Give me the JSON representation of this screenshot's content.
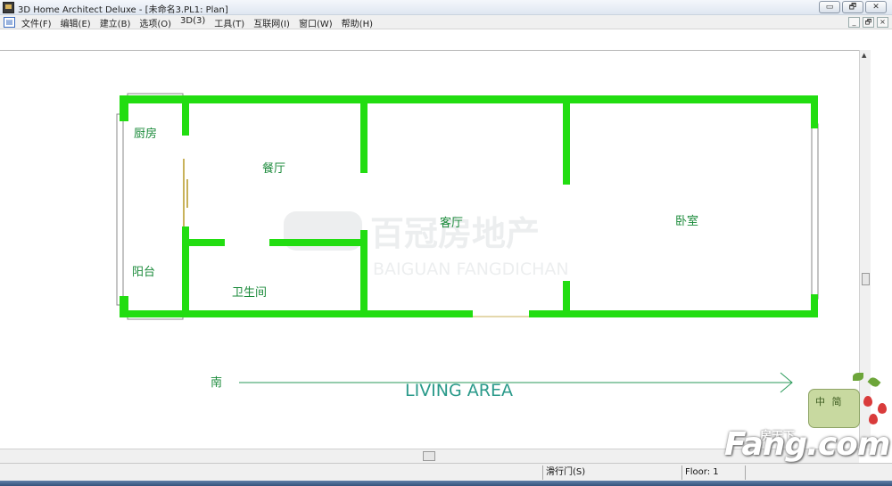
{
  "window": {
    "title": "3D Home Architect Deluxe - [未命名3.PL1: Plan]",
    "buttons": [
      "▭",
      "🗗",
      "✕"
    ]
  },
  "menubar": {
    "items": [
      "文件(F)",
      "编辑(E)",
      "建立(B)",
      "选项(O)",
      "3D(3)",
      "工具(T)",
      "互联网(I)",
      "窗口(W)",
      "帮助(H)"
    ],
    "doc_buttons": [
      "_",
      "🗗",
      "×"
    ]
  },
  "plan": {
    "rooms": {
      "kitchen": "厨房",
      "dining": "餐厅",
      "living": "客厅",
      "bedroom": "卧室",
      "balcony": "阳台",
      "bathroom": "卫生间"
    },
    "direction_label": "南",
    "area_label": "LIVING AREA",
    "watermark_cn": "百冠房地产",
    "watermark_en": "BAIGUAN FANGDICHAN",
    "wall_color": "#22dd11",
    "label_color": "#1a8a3a",
    "area_label_color": "#2a9a8a"
  },
  "statusbar": {
    "tool": "滑行门(S)",
    "floor": "Floor: 1"
  },
  "badge": {
    "text": "中 简"
  },
  "brand": {
    "logo_text": "Fang.com",
    "logo_cn": "房天下"
  }
}
